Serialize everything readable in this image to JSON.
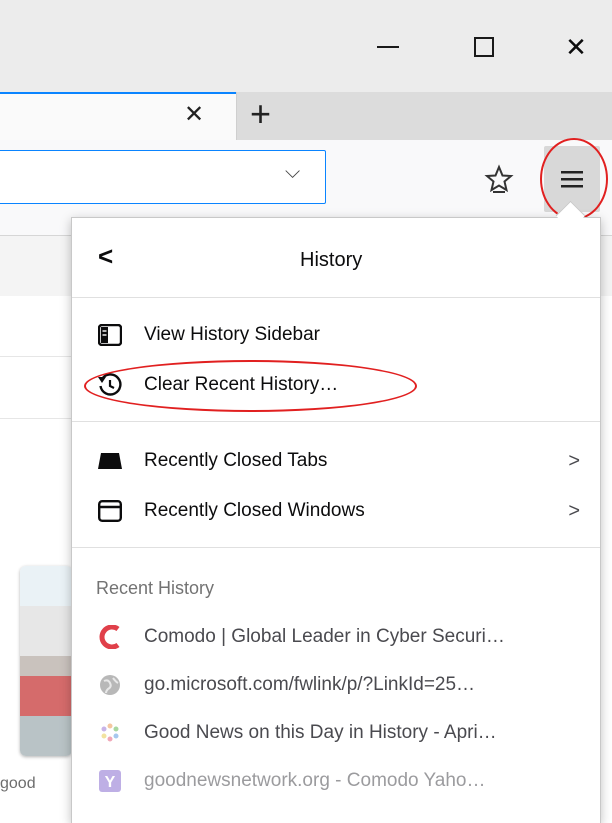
{
  "window": {
    "tab_close_glyph": "✕",
    "new_tab_glyph": "+",
    "minimize_glyph": "—",
    "close_glyph": "✕"
  },
  "urlbar": {
    "dropdown_glyph": "⌵"
  },
  "panel": {
    "title": "History",
    "back_glyph": "<",
    "items": [
      {
        "label": "View History Sidebar",
        "icon": "sidebar-icon"
      },
      {
        "label": "Clear Recent History…",
        "icon": "clear-history-icon"
      },
      {
        "label": "Recently Closed Tabs",
        "icon": "closed-tabs-icon",
        "chevron": ">"
      },
      {
        "label": "Recently Closed Windows",
        "icon": "closed-windows-icon",
        "chevron": ">"
      }
    ],
    "recent_header": "Recent History",
    "recent": [
      {
        "label": "Comodo | Global Leader in Cyber Securi…",
        "icon": "comodo-icon"
      },
      {
        "label": "go.microsoft.com/fwlink/p/?LinkId=25…",
        "icon": "globe-icon"
      },
      {
        "label": "Good News on this Day in History - Apri…",
        "icon": "goodnews-icon"
      },
      {
        "label": "goodnewsnetwork.org - Comodo Yaho…",
        "icon": "yahoo-icon"
      }
    ]
  },
  "page": {
    "thumb_label": "good"
  },
  "colors": {
    "accent": "#0a84ff",
    "annotation": "#e12020"
  }
}
